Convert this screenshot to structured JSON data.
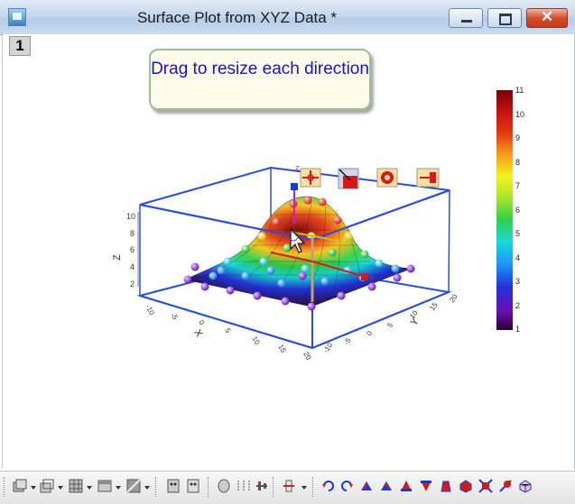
{
  "window": {
    "title": "Surface Plot from XYZ Data *",
    "close_glyph": "✕",
    "layer_number": "1"
  },
  "tooltip": {
    "text": "Drag to resize each direction"
  },
  "chart_data": {
    "type": "surface3d",
    "title": "",
    "axes": {
      "x": {
        "label": "X",
        "ticks": [
          "-10",
          "-5",
          "0",
          "5",
          "10",
          "15",
          "20"
        ]
      },
      "y": {
        "label": "Y",
        "ticks": [
          "-10",
          "-5",
          "0",
          "5",
          "10",
          "15",
          "20"
        ]
      },
      "z": {
        "label": "Z",
        "ticks": [
          "2",
          "4",
          "6",
          "8",
          "10"
        ],
        "range": [
          1,
          11
        ]
      }
    },
    "colorscale": {
      "ticks": [
        "1",
        "2",
        "3",
        "4",
        "5",
        "6",
        "7",
        "8",
        "9",
        "10",
        "11"
      ],
      "min": 1,
      "max": 11
    },
    "surface": {
      "shape": "gaussian peak",
      "peak_z": 11,
      "base_z": 1
    },
    "grid": false
  },
  "edit_buttons": [
    {
      "name": "move-icon"
    },
    {
      "name": "resize-icon"
    },
    {
      "name": "rotate-icon"
    },
    {
      "name": "skew-icon"
    }
  ],
  "colors": {
    "frame": "#2b4dd6",
    "tooltip_text": "#1414c8",
    "colormap": [
      "#3a0a4a",
      "#5a0fa8",
      "#2233d8",
      "#1a9bff",
      "#19d8d6",
      "#2fd14a",
      "#a6e62c",
      "#f5f21a",
      "#f5a01a",
      "#e23a12",
      "#c4120f",
      "#7a0008"
    ]
  }
}
